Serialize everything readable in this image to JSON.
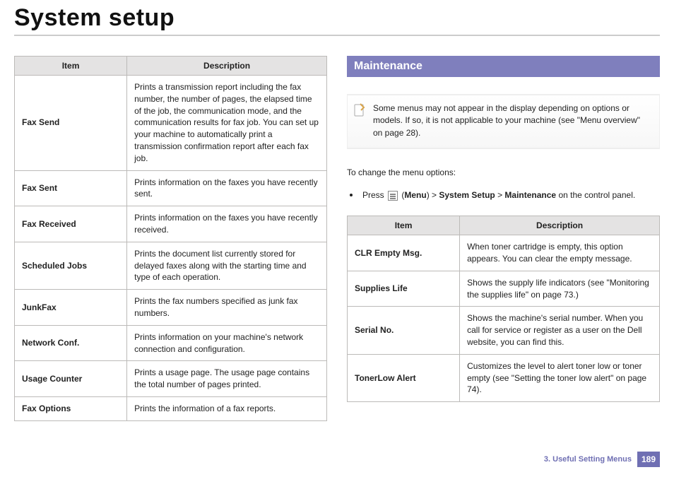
{
  "page_title": "System setup",
  "left_table": {
    "headers": [
      "Item",
      "Description"
    ],
    "rows": [
      {
        "item": "Fax Send",
        "desc": "Prints a transmission report including the fax number, the number of pages, the elapsed time of the job, the communication mode, and the communication results for fax job. You can set up your machine to automatically print a transmission confirmation report after each fax job."
      },
      {
        "item": "Fax Sent",
        "desc": "Prints information on the faxes you have recently sent."
      },
      {
        "item": "Fax Received",
        "desc": "Prints information on the faxes you have recently received."
      },
      {
        "item": "Scheduled Jobs",
        "desc": "Prints the document list currently stored for delayed faxes along with the starting time and type of each operation."
      },
      {
        "item": "JunkFax",
        "desc": "Prints the fax numbers specified as junk fax numbers."
      },
      {
        "item": "Network Conf.",
        "desc": "Prints information on your machine's network connection and configuration."
      },
      {
        "item": "Usage Counter",
        "desc": "Prints a usage page. The usage page contains the total number of pages printed."
      },
      {
        "item": "Fax Options",
        "desc": "Prints the information of a fax reports."
      }
    ]
  },
  "right": {
    "section_title": "Maintenance",
    "note_text": "Some menus may not appear in the display depending on options or models. If so, it is not applicable to your machine (see \"Menu overview\" on page 28).",
    "intro_text": "To change the menu options:",
    "bullet_prefix": "Press ",
    "bullet_menu_open": " (",
    "bullet_menu_label": "Menu",
    "bullet_sep1": ") > ",
    "bullet_path1": "System Setup",
    "bullet_sep2": " > ",
    "bullet_path2": "Maintenance",
    "bullet_suffix": " on the control panel.",
    "table": {
      "headers": [
        "Item",
        "Description"
      ],
      "rows": [
        {
          "item": "CLR Empty Msg.",
          "desc": "When toner cartridge is empty, this option appears. You can clear the empty message."
        },
        {
          "item": "Supplies Life",
          "desc": "Shows the supply life indicators (see \"Monitoring the supplies life\" on page 73.)"
        },
        {
          "item": "Serial No.",
          "desc": "Shows the machine's serial number. When you call for service or register as a user on the Dell website, you can find this."
        },
        {
          "item": "TonerLow Alert",
          "desc": "Customizes the level to alert toner low or toner empty (see \"Setting the toner low alert\" on page 74)."
        }
      ]
    }
  },
  "footer": {
    "chapter": "3.  Useful Setting Menus",
    "page_number": "189"
  }
}
